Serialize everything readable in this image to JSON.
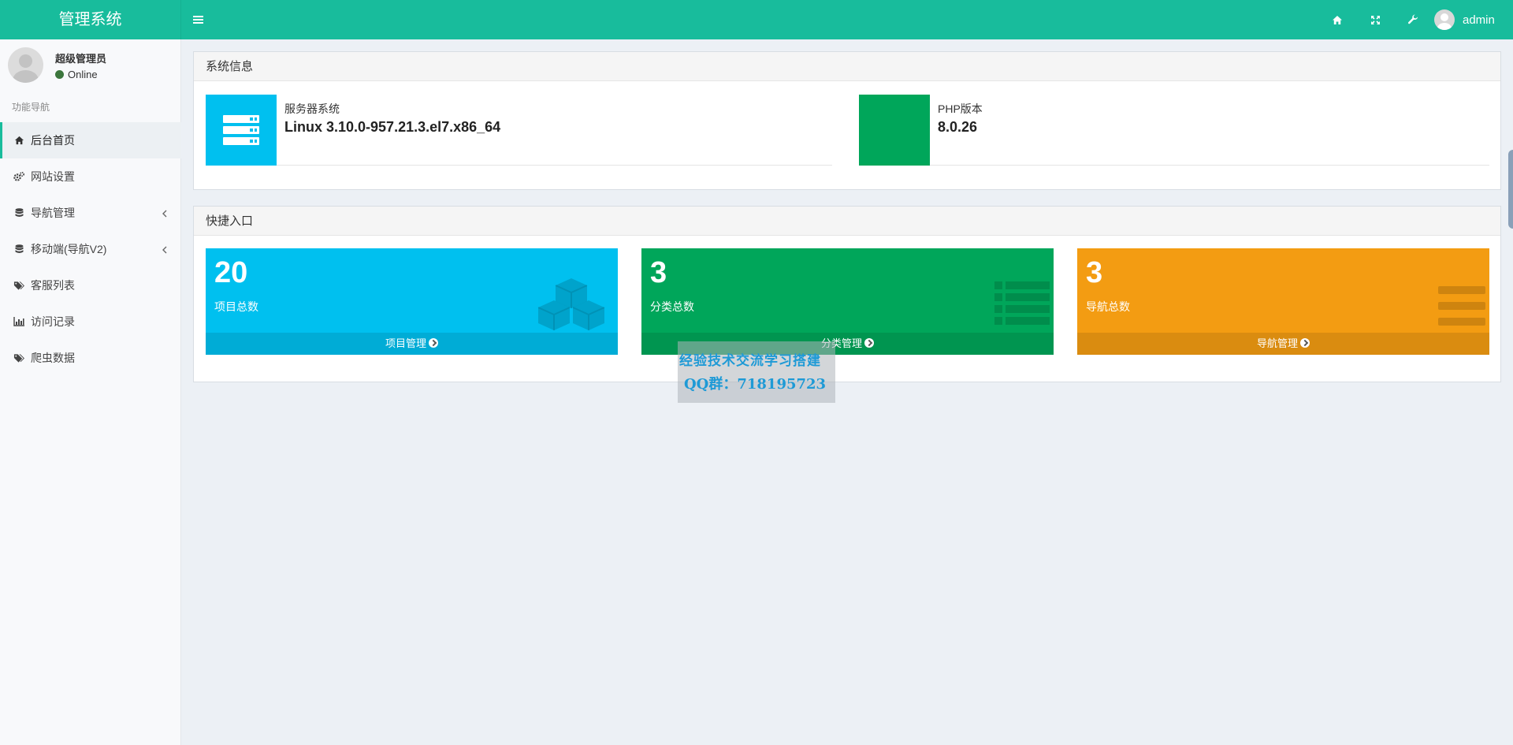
{
  "header": {
    "logo": "管理系统",
    "user_name": "admin"
  },
  "sidebar": {
    "user_name": "超级管理员",
    "user_status": "Online",
    "nav_header": "功能导航",
    "items": [
      {
        "label": "后台首页",
        "icon": "home-icon",
        "active": true
      },
      {
        "label": "网站设置",
        "icon": "gears-icon"
      },
      {
        "label": "导航管理",
        "icon": "database-icon",
        "has_children": true
      },
      {
        "label": "移动端(导航V2)",
        "icon": "database-icon",
        "has_children": true
      },
      {
        "label": "客服列表",
        "icon": "tags-icon"
      },
      {
        "label": "访问记录",
        "icon": "bar-chart-icon"
      },
      {
        "label": "爬虫数据",
        "icon": "tags-icon"
      }
    ]
  },
  "system_info": {
    "title": "系统信息",
    "server": {
      "label": "服务器系统",
      "value": "Linux 3.10.0-957.21.3.el7.x86_64",
      "color": "#00c0ef"
    },
    "php": {
      "label": "PHP版本",
      "value": "8.0.26",
      "color": "#00a65a"
    }
  },
  "quick_entry": {
    "title": "快捷入口",
    "boxes": [
      {
        "count": "20",
        "label": "项目总数",
        "link": "项目管理",
        "color": "#00c0ef",
        "icon": "cubes-icon"
      },
      {
        "count": "3",
        "label": "分类总数",
        "link": "分类管理",
        "color": "#00a65a",
        "icon": "list-icon"
      },
      {
        "count": "3",
        "label": "导航总数",
        "link": "导航管理",
        "color": "#f39c12",
        "icon": "bars-icon"
      }
    ]
  },
  "watermark": {
    "line1": "经验技术交流学习搭建",
    "line2": "QQ群：718195723"
  }
}
